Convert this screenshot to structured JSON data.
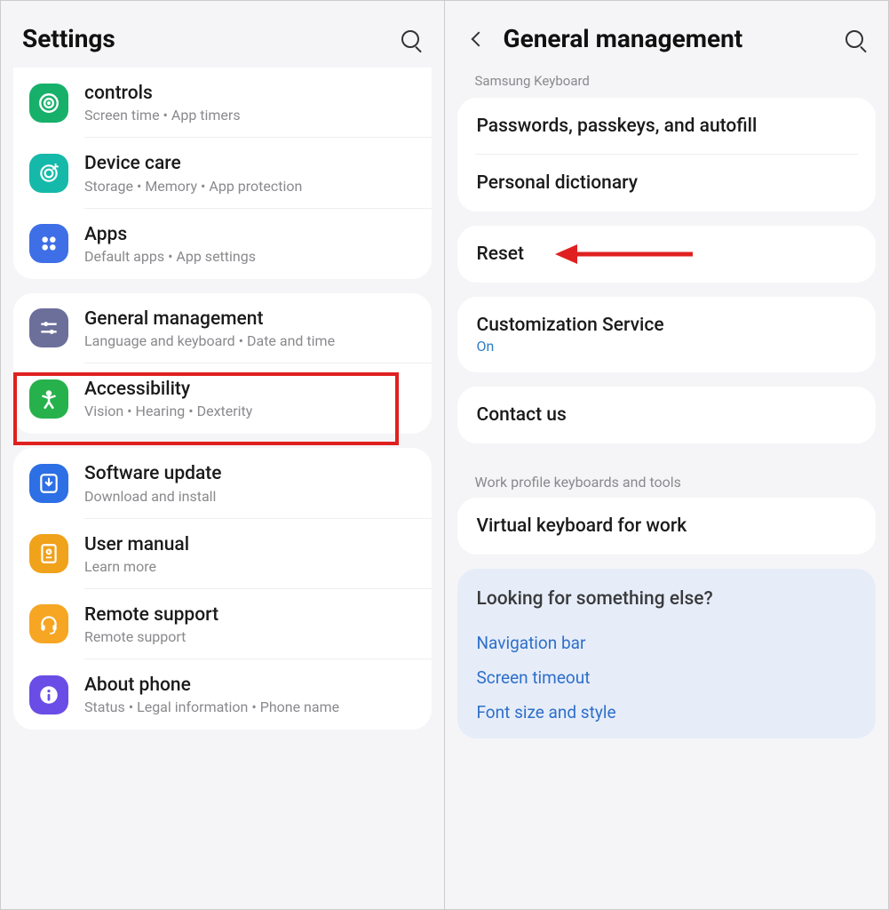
{
  "left": {
    "title": "Settings",
    "groups": [
      {
        "id": "g1",
        "top_cut": true,
        "items": [
          {
            "title_partial": "controls",
            "sub": "Screen time  •  App timers",
            "icon": "bullseye",
            "color": "bg-green",
            "sep": true
          },
          {
            "title": "Device care",
            "sub": "Storage  •  Memory  •  App protection",
            "icon": "target",
            "color": "bg-teal",
            "sep": true
          },
          {
            "title": "Apps",
            "sub": "Default apps  •  App settings",
            "icon": "grid4",
            "color": "bg-blue",
            "sep": false
          }
        ]
      },
      {
        "id": "g2",
        "items": [
          {
            "title": "General management",
            "sub": "Language and keyboard  •  Date and time",
            "icon": "sliders",
            "color": "bg-slate",
            "sep": true,
            "highlight": true
          },
          {
            "title": "Accessibility",
            "sub": "Vision  •  Hearing  •  Dexterity",
            "icon": "person",
            "color": "bg-green2",
            "sep": false
          }
        ]
      },
      {
        "id": "g3",
        "items": [
          {
            "title": "Software update",
            "sub": "Download and install",
            "icon": "download",
            "color": "bg-blue2",
            "sep": true
          },
          {
            "title": "User manual",
            "sub": "Learn more",
            "icon": "book",
            "color": "bg-orange",
            "sep": true
          },
          {
            "title": "Remote support",
            "sub": "Remote support",
            "icon": "headset",
            "color": "bg-orange2",
            "sep": true
          },
          {
            "title": "About phone",
            "sub": "Status  •  Legal information  •  Phone name",
            "icon": "info",
            "color": "bg-violet",
            "sep": false
          }
        ]
      }
    ]
  },
  "right": {
    "title": "General management",
    "top_label": "Samsung Keyboard",
    "group1": [
      {
        "title": "Passwords, passkeys, and autofill",
        "sep": true
      },
      {
        "title": "Personal dictionary",
        "sep": false
      }
    ],
    "reset": {
      "title": "Reset",
      "arrow": true
    },
    "cust": {
      "title": "Customization Service",
      "status": "On"
    },
    "contact": {
      "title": "Contact us"
    },
    "work_section": "Work profile keyboards and tools",
    "work_item": {
      "title": "Virtual keyboard for work"
    },
    "suggest": {
      "heading": "Looking for something else?",
      "links": [
        "Navigation bar",
        "Screen timeout",
        "Font size and style"
      ]
    }
  }
}
